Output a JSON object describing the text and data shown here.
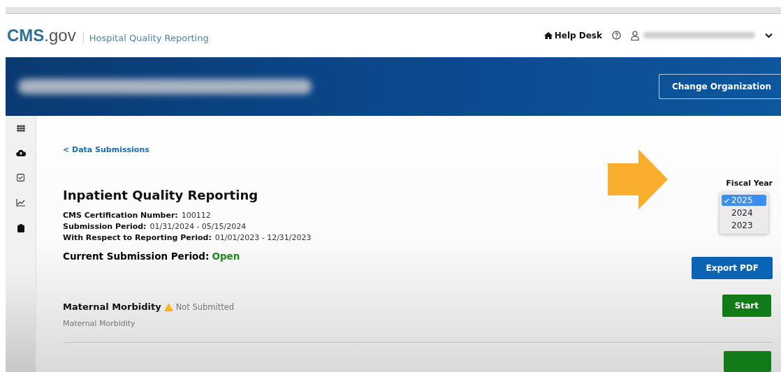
{
  "header": {
    "logo_main": "CMS",
    "logo_suffix": ".gov",
    "site_name": "Hospital Quality Reporting",
    "help_desk": "Help Desk"
  },
  "banner": {
    "change_org_button": "Change Organization"
  },
  "sidebar": {
    "items": [
      {
        "kind": "table"
      },
      {
        "kind": "upload"
      },
      {
        "kind": "checklist"
      },
      {
        "kind": "chart"
      },
      {
        "kind": "clipboard"
      }
    ]
  },
  "back_link": "< Data Submissions",
  "fiscal_year": {
    "label": "Fiscal Year",
    "options": [
      {
        "label": "2025",
        "selected": true
      },
      {
        "label": "2024",
        "selected": false
      },
      {
        "label": "2023",
        "selected": false
      }
    ]
  },
  "program": {
    "title": "Inpatient Quality Reporting",
    "details": [
      {
        "label": "CMS Certification Number:",
        "value": "100112"
      },
      {
        "label": "Submission Period:",
        "value": "01/31/2024 - 05/15/2024"
      },
      {
        "label": "With Respect to Reporting Period:",
        "value": "01/01/2023 - 12/31/2023"
      }
    ],
    "status_label": "Current Submission Period:",
    "status_value": "Open",
    "export_button": "Export PDF"
  },
  "measures": [
    {
      "name": "Maternal Morbidity",
      "status": "Not Submitted",
      "description": "Maternal Morbidity",
      "button": "Start"
    }
  ]
}
